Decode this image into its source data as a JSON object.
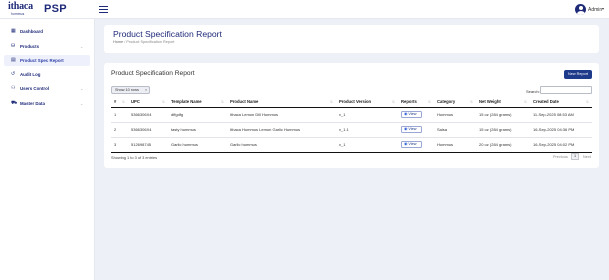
{
  "brand": {
    "logo_text": "ithaca",
    "logo_sub": "hummus",
    "app_name": "PSP"
  },
  "user": {
    "name": "Admin",
    "caret": "▾"
  },
  "sidebar": {
    "items": [
      {
        "label": "Dashboard",
        "icon": "grid-icon",
        "glyph": "▦"
      },
      {
        "label": "Products",
        "icon": "boxes-icon",
        "glyph": "⛁",
        "chevron": "⌄"
      },
      {
        "label": "Product Spec Report",
        "icon": "document-icon",
        "glyph": "▤"
      },
      {
        "label": "Audit Log",
        "icon": "history-icon",
        "glyph": "↺"
      },
      {
        "label": "Users Control",
        "icon": "users-icon",
        "glyph": "⚇",
        "chevron": "⌄"
      },
      {
        "label": "Master Data",
        "icon": "cart-icon",
        "glyph": "⛟",
        "chevron": "⌄"
      }
    ]
  },
  "header": {
    "title": "Product Specification Report",
    "breadcrumb_home": "Home",
    "breadcrumb_sep": "/",
    "breadcrumb_current": "Product Specification Report"
  },
  "report": {
    "title": "Product Specification Report",
    "new_button": "New Report",
    "show_rows": "Show 10 rows",
    "show_clear": "×",
    "search_label": "Search:",
    "search_value": "",
    "columns": [
      "#",
      "UPC",
      "Template Name",
      "Product Name",
      "Product Version",
      "Reports",
      "Category",
      "Net Weight",
      "Created Date"
    ],
    "rows": [
      {
        "num": "1",
        "upc": "5366306X4",
        "template": "dffgdfg",
        "product": "Ithaca Lemon Dill Hummus",
        "version": "v_1",
        "report": "View",
        "category": "Hummus",
        "weight": "15 oz (284 grams)",
        "date": "11-Sep-2025 08:53 AM"
      },
      {
        "num": "2",
        "upc": "5366306X4",
        "template": "tasty hummus",
        "product": "Ithaca Hummus Lemon Garlic Hummus",
        "version": "v_1.1",
        "report": "View",
        "category": "Salsa",
        "weight": "15 oz (284 grams)",
        "date": "16-Sep-2025 04:36 PM"
      },
      {
        "num": "3",
        "upc": "512698745",
        "template": "Garlic hummus",
        "product": "Garlic hummus",
        "version": "v_1",
        "report": "View",
        "category": "Hummus",
        "weight": "20 oz (284 grams)",
        "date": "16-Sep-2025 04:02 PM"
      }
    ],
    "info": "Showing 1 to 3 of 3 entries",
    "pager_prev": "Previous",
    "pager_current": "1",
    "pager_next": "Next"
  },
  "colors": {
    "brand": "#1e2a78",
    "button": "#1e3a8a",
    "background": "#eef0f7"
  }
}
